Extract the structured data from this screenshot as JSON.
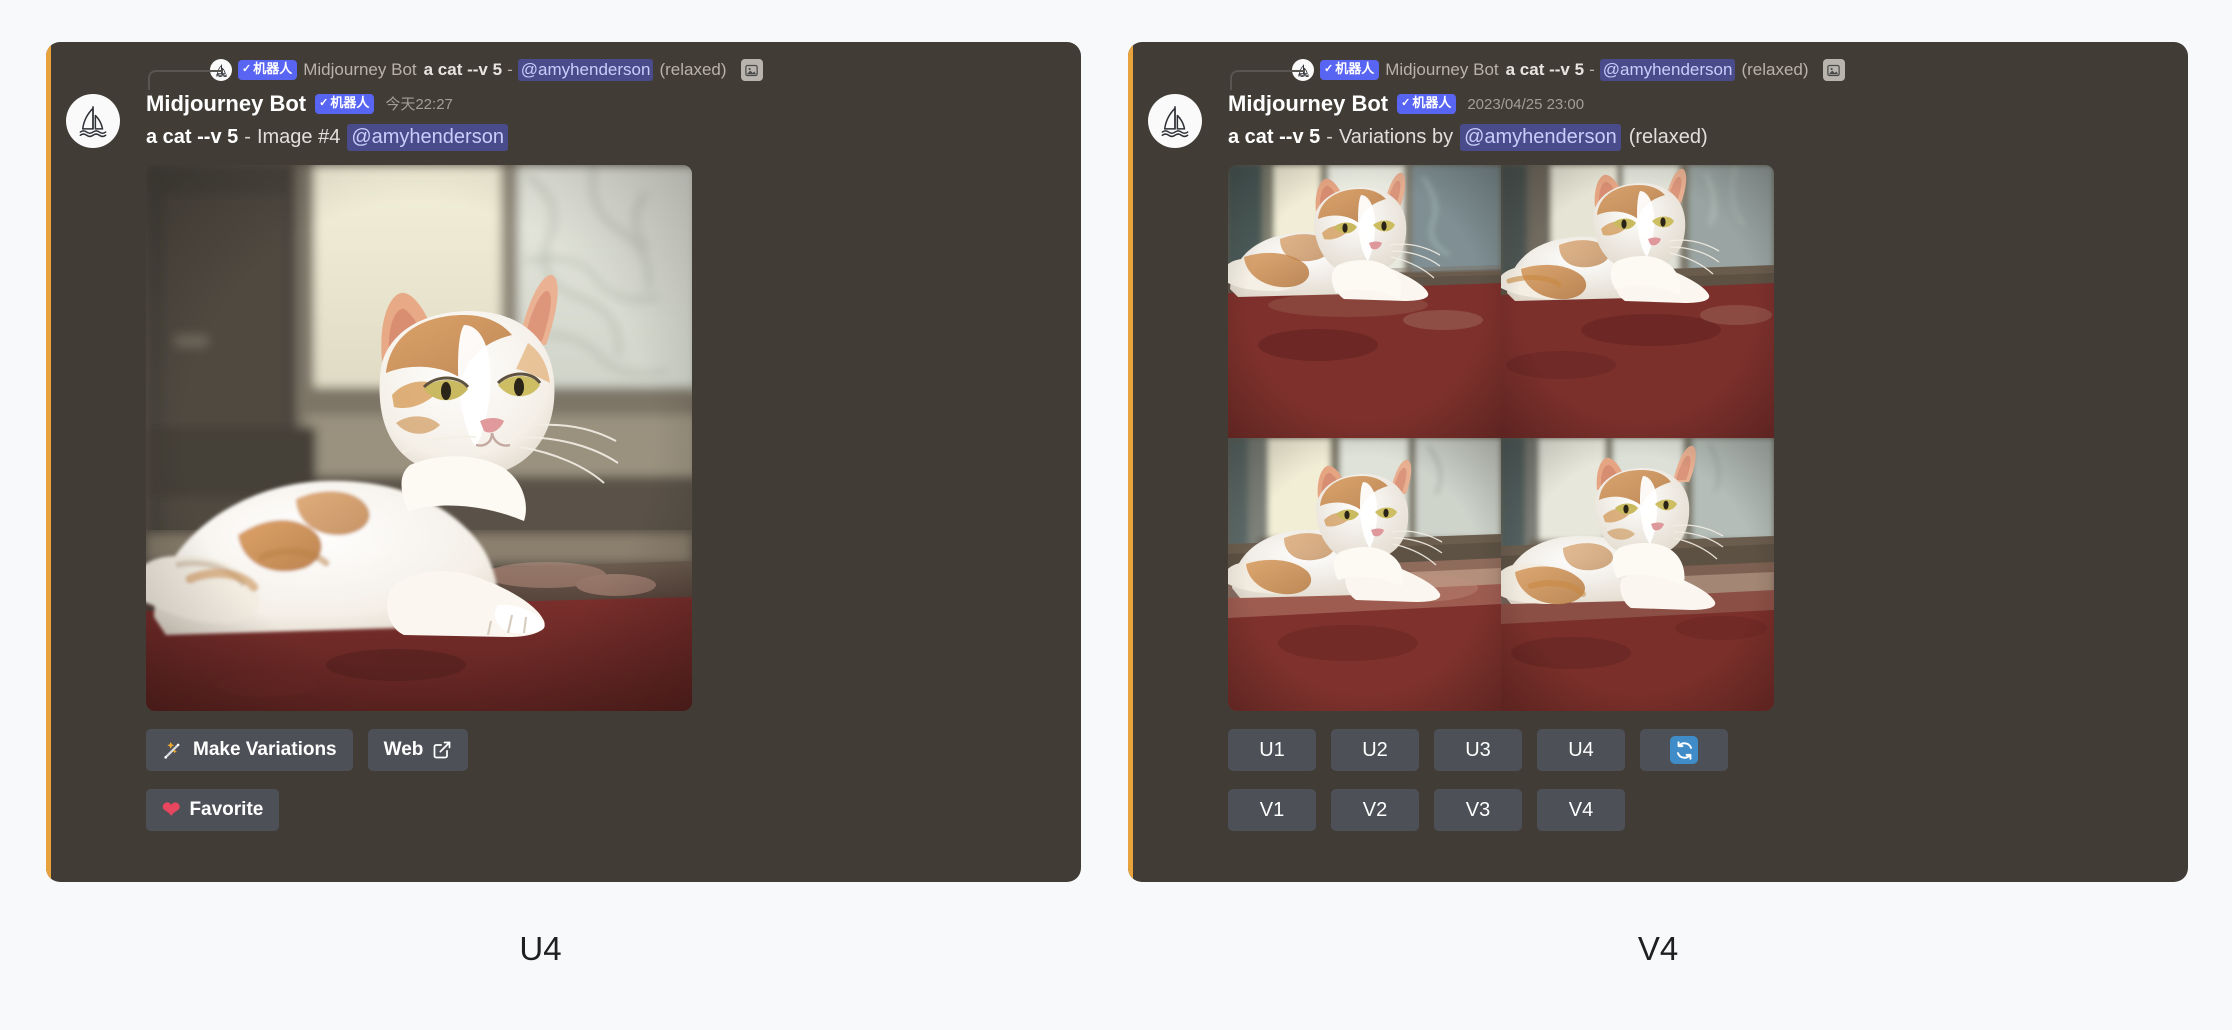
{
  "theme": {
    "page_bg": "#f8f9fa",
    "panel_bg": "#413d36",
    "accent_bar": "#e8a33d",
    "button_bg": "#4e5058",
    "bot_tag_bg": "#5865f2",
    "mention_bg": "#4a4b8a",
    "mention_fg": "#c9cdfb",
    "refresh_blue": "#3f8cc9",
    "heart_red": "#e8465e",
    "caption_fg": "#1d1f21"
  },
  "left_panel": {
    "reply": {
      "avatar_icon": "sailboat-icon",
      "bot_tag": "机器人",
      "bot_tag_check": "✓",
      "author": "Midjourney Bot",
      "prompt": "a cat --v 5",
      "dash": "-",
      "mention": "@amyhenderson",
      "mode": "(relaxed)",
      "attachment_icon": "image-icon"
    },
    "message": {
      "avatar_icon": "sailboat-icon",
      "author": "Midjourney Bot",
      "bot_tag": "机器人",
      "bot_tag_check": "✓",
      "timestamp": "今天22:27",
      "prompt": "a cat --v 5",
      "dash": "-",
      "detail": "Image #4",
      "mention": "@amyhenderson"
    },
    "image": {
      "alt": "A white and orange cat sitting on a windowsill",
      "layout": "single"
    },
    "buttons": [
      {
        "id": "make-variations",
        "label": "Make Variations",
        "icon": "wand-sparkles-icon"
      },
      {
        "id": "web",
        "label": "Web",
        "icon": "external-link-icon"
      },
      {
        "id": "favorite",
        "label": "Favorite",
        "icon": "heart-icon"
      }
    ],
    "caption": "U4"
  },
  "right_panel": {
    "reply": {
      "avatar_icon": "sailboat-icon",
      "bot_tag": "机器人",
      "bot_tag_check": "✓",
      "author": "Midjourney Bot",
      "prompt": "a cat --v 5",
      "dash": "-",
      "mention": "@amyhenderson",
      "mode": "(relaxed)",
      "attachment_icon": "image-icon"
    },
    "message": {
      "avatar_icon": "sailboat-icon",
      "author": "Midjourney Bot",
      "bot_tag": "机器人",
      "bot_tag_check": "✓",
      "timestamp": "2023/04/25 23:00",
      "prompt": "a cat --v 5",
      "dash": "-",
      "detail": "Variations by",
      "mention": "@amyhenderson",
      "mode": "(relaxed)"
    },
    "image": {
      "alt": "Four variations of a white and orange cat on a windowsill",
      "layout": "2x2-grid"
    },
    "upscale_buttons": [
      {
        "id": "u1",
        "label": "U1"
      },
      {
        "id": "u2",
        "label": "U2"
      },
      {
        "id": "u3",
        "label": "U3"
      },
      {
        "id": "u4",
        "label": "U4"
      }
    ],
    "refresh_button": {
      "id": "reroll",
      "icon": "refresh-icon",
      "label": ""
    },
    "variation_buttons": [
      {
        "id": "v1",
        "label": "V1"
      },
      {
        "id": "v2",
        "label": "V2"
      },
      {
        "id": "v3",
        "label": "V3"
      },
      {
        "id": "v4",
        "label": "V4"
      }
    ],
    "caption": "V4"
  }
}
